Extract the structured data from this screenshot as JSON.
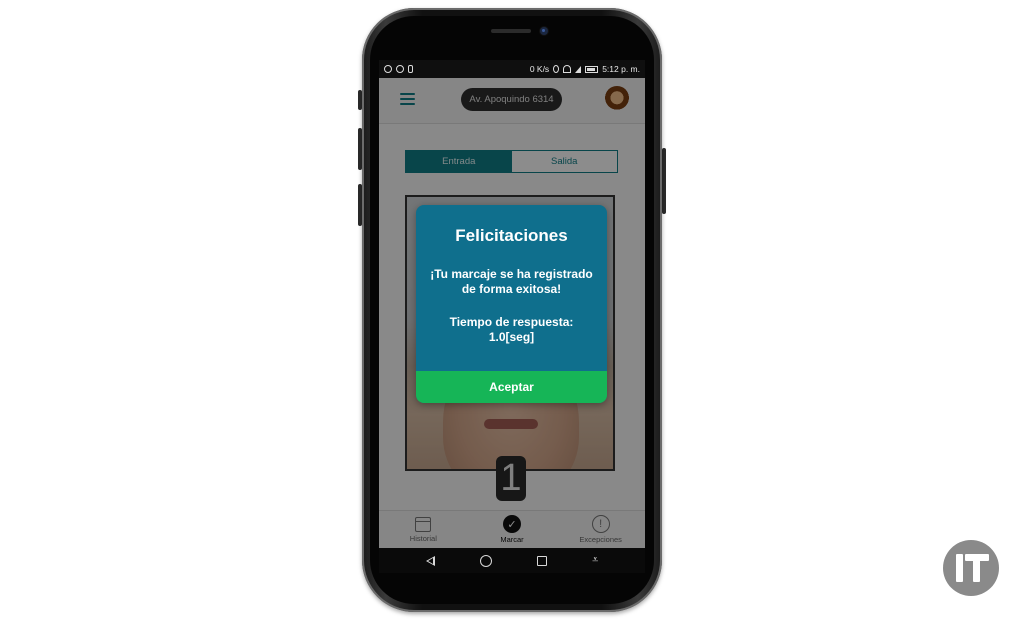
{
  "status_bar": {
    "network_speed": "0 K/s",
    "time": "5:12 p. m."
  },
  "app_bar": {
    "address": "Av. Apoquindo 6314"
  },
  "segments": {
    "entrada": "Entrada",
    "salida": "Salida",
    "selected": "Entrada"
  },
  "countdown": "1",
  "dialog": {
    "title": "Felicitaciones",
    "message": "¡Tu marcaje se ha registrado de forma exitosa!",
    "time_label": "Tiempo de respuesta:",
    "time_value": "1.0[seg]",
    "button": "Aceptar"
  },
  "tabs": [
    {
      "label": "Historial",
      "icon": "calendar-icon"
    },
    {
      "label": "Marcar",
      "icon": "check-circle-icon",
      "active": true
    },
    {
      "label": "Excepciones",
      "icon": "alert-circle-icon"
    }
  ],
  "colors": {
    "primary": "#0f7e88",
    "dialog_bg": "#0f6f8d",
    "accept_green": "#16b557"
  }
}
